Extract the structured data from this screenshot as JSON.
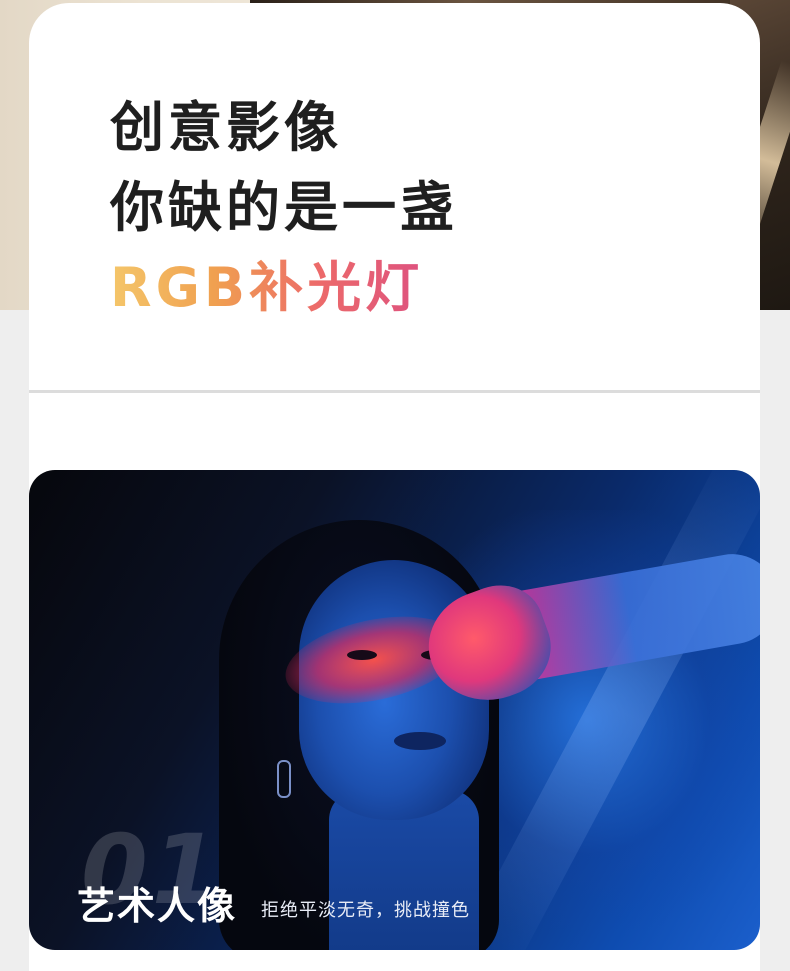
{
  "hero": {
    "line1": "创意影像",
    "line2": "你缺的是一盏",
    "line3": "RGB补光灯"
  },
  "feature": {
    "number": "01",
    "title": "艺术人像",
    "subtitle": "拒绝平淡无奇，挑战撞色"
  },
  "colors": {
    "page_background": "#eeeeee",
    "card_background": "#ffffff",
    "headline_text": "#1f1f1f",
    "gradient_start": "#f4c66a",
    "gradient_mid": "#ec6a6a",
    "gradient_end": "#d94a86",
    "feature_blue": "#0e4cb0"
  }
}
